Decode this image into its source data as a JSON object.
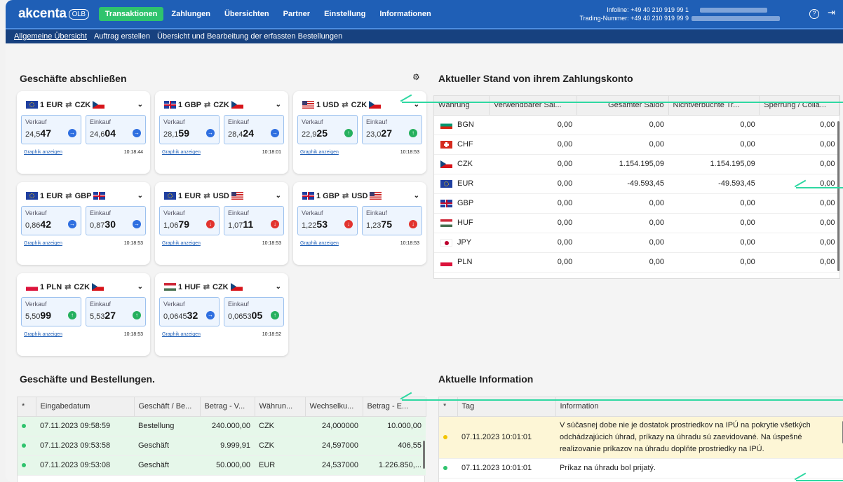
{
  "brand": {
    "name": "akcenta",
    "sub": "OLB"
  },
  "nav": [
    "Transaktionen",
    "Zahlungen",
    "Übersichten",
    "Partner",
    "Einstellung",
    "Informationen"
  ],
  "infoline": {
    "line1": "Infoline: +49 40 210 919 99 1",
    "line2": "Trading-Nummer: +49 40 210 919 99 9"
  },
  "subnav": [
    "Allgemeine Übersicht",
    "Auftrag erstellen",
    "Übersicht und Bearbeitung der erfassten Bestellungen"
  ],
  "sections": {
    "deals": "Geschäfte abschließen",
    "account": "Aktueller Stand von ihrem Zahlungskonto",
    "orders": "Geschäfte und Bestellungen.",
    "info": "Aktuelle Information"
  },
  "cards": [
    {
      "pair": [
        "1 EUR",
        "CZK"
      ],
      "sell_pre": "24,5",
      "sell_big": "47",
      "buy_pre": "24,6",
      "buy_big": "04",
      "s_icon": "arrow-right-icon",
      "b_icon": "arrow-right-icon",
      "time": "10:18:44"
    },
    {
      "pair": [
        "1 GBP",
        "CZK"
      ],
      "sell_pre": "28,1",
      "sell_big": "59",
      "buy_pre": "28,4",
      "buy_big": "24",
      "s_icon": "arrow-right-icon",
      "b_icon": "arrow-right-icon",
      "time": "10:18:01"
    },
    {
      "pair": [
        "1 USD",
        "CZK"
      ],
      "sell_pre": "22,9",
      "sell_big": "25",
      "buy_pre": "23,0",
      "buy_big": "27",
      "s_icon": "arrow-up-icon",
      "b_icon": "arrow-up-icon",
      "time": "10:18:53"
    },
    {
      "pair": [
        "1 EUR",
        "GBP"
      ],
      "sell_pre": "0,86",
      "sell_big": "42",
      "buy_pre": "0,87",
      "buy_big": "30",
      "s_icon": "arrow-right-icon",
      "b_icon": "arrow-right-icon",
      "time": "10:18:53"
    },
    {
      "pair": [
        "1 EUR",
        "USD"
      ],
      "sell_pre": "1,06",
      "sell_big": "79",
      "buy_pre": "1,07",
      "buy_big": "11",
      "s_icon": "arrow-down-icon",
      "b_icon": "arrow-down-icon",
      "time": "10:18:53"
    },
    {
      "pair": [
        "1 GBP",
        "USD"
      ],
      "sell_pre": "1,22",
      "sell_big": "53",
      "buy_pre": "1,23",
      "buy_big": "75",
      "s_icon": "arrow-down-icon",
      "b_icon": "arrow-down-icon",
      "time": "10:18:53"
    },
    {
      "pair": [
        "1 PLN",
        "CZK"
      ],
      "sell_pre": "5,50",
      "sell_big": "99",
      "buy_pre": "5,53",
      "buy_big": "27",
      "s_icon": "arrow-up-icon",
      "b_icon": "arrow-up-icon",
      "time": "10:18:53"
    },
    {
      "pair": [
        "1 HUF",
        "CZK"
      ],
      "sell_pre": "0,0645",
      "sell_big": "32",
      "buy_pre": "0,0653",
      "buy_big": "05",
      "s_icon": "arrow-right-icon",
      "b_icon": "arrow-up-icon",
      "time": "10:18:52"
    }
  ],
  "card_labels": {
    "sell": "Verkauf",
    "buy": "Einkauf",
    "graph": "Graphik anzeigen"
  },
  "account": {
    "headers": [
      "Währung",
      "Verwendbarer Sal...",
      "Gesamter Saldo",
      "Nichtverbuchte Tr...",
      "Sperrung / Colla..."
    ],
    "rows": [
      [
        "BGN",
        "0,00",
        "0,00",
        "0,00",
        "0,00"
      ],
      [
        "CHF",
        "0,00",
        "0,00",
        "0,00",
        "0,00"
      ],
      [
        "CZK",
        "0,00",
        "1.154.195,09",
        "1.154.195,09",
        "0,00"
      ],
      [
        "EUR",
        "0,00",
        "-49.593,45",
        "-49.593,45",
        "0,00"
      ],
      [
        "GBP",
        "0,00",
        "0,00",
        "0,00",
        "0,00"
      ],
      [
        "HUF",
        "0,00",
        "0,00",
        "0,00",
        "0,00"
      ],
      [
        "JPY",
        "0,00",
        "0,00",
        "0,00",
        "0,00"
      ],
      [
        "PLN",
        "0,00",
        "0,00",
        "0,00",
        "0,00"
      ]
    ]
  },
  "orders": {
    "headers": [
      "*",
      "Eingabedatum",
      "Geschäft / Be...",
      "Betrag - V...",
      "Währun...",
      "Wechselku...",
      "Betrag - E..."
    ],
    "rows": [
      [
        "07.11.2023 09:58:59",
        "Bestellung",
        "240.000,00",
        "CZK",
        "24,000000",
        "10.000,00"
      ],
      [
        "07.11.2023 09:53:58",
        "Geschäft",
        "9.999,91",
        "CZK",
        "24,597000",
        "406,55"
      ],
      [
        "07.11.2023 09:53:08",
        "Geschäft",
        "50.000,00",
        "EUR",
        "24,537000",
        "1.226.850,..."
      ]
    ]
  },
  "info": {
    "headers": [
      "*",
      "Tag",
      "Information"
    ],
    "rows": [
      {
        "date": "07.11.2023 10:01:01",
        "text": "V súčasnej dobe nie je dostatok prostriedkov na IPÚ na pokrytie všetkých odchádzajúcich úhrad, príkazy na úhradu sú zaevidované. Na úspešné realizovanie príkazov na úhradu doplňte prostriedky na IPÚ.",
        "color": "#f2c400"
      },
      {
        "date": "07.11.2023 10:01:01",
        "text": "Príkaz na úhradu bol prijatý.",
        "color": "#2fc36d"
      }
    ]
  },
  "colors": {
    "brand": "#1f5fb6",
    "accent": "#2fc36d",
    "subnav": "#17417f",
    "arrow": "#2fd8a2"
  }
}
